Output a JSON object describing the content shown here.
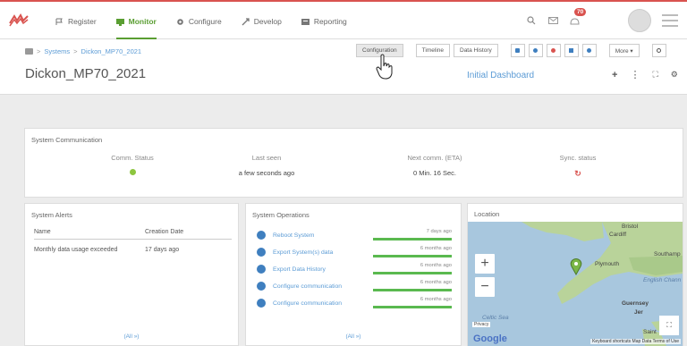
{
  "nav": {
    "items": [
      {
        "label": "Register",
        "icon": "flag-icon"
      },
      {
        "label": "Monitor",
        "icon": "monitor-icon",
        "active": true
      },
      {
        "label": "Configure",
        "icon": "gear-icon"
      },
      {
        "label": "Develop",
        "icon": "develop-icon"
      },
      {
        "label": "Reporting",
        "icon": "report-icon"
      }
    ],
    "notifications_count": "70"
  },
  "breadcrumb": {
    "root": "Systems",
    "current": "Dickon_MP70_2021"
  },
  "page_title": "Dickon_MP70_2021",
  "toolbar": {
    "configuration": "Configuration",
    "timeline": "Timeline",
    "data_history": "Data History",
    "more": "More ▾"
  },
  "dashboard_title": "Initial Dashboard",
  "communication": {
    "title": "System Communication",
    "comm_status_label": "Comm. Status",
    "last_seen_label": "Last seen",
    "last_seen_value": "a few seconds ago",
    "next_comm_label": "Next comm. (ETA)",
    "next_comm_value": "0 Min. 16 Sec.",
    "sync_label": "Sync. status"
  },
  "alerts": {
    "title": "System Alerts",
    "col_name": "Name",
    "col_date": "Creation Date",
    "rows": [
      {
        "name": "Monthly data usage exceeded",
        "date": "17 days ago"
      }
    ],
    "all_link": "(All »)"
  },
  "operations": {
    "title": "System Operations",
    "items": [
      {
        "label": "Reboot System",
        "time": "7 days ago"
      },
      {
        "label": "Export System(s) data",
        "time": "6 months ago"
      },
      {
        "label": "Export Data History",
        "time": "6 months ago"
      },
      {
        "label": "Configure communication",
        "time": "6 months ago"
      },
      {
        "label": "Configure communication",
        "time": "6 months ago"
      }
    ],
    "all_link": "(All »)"
  },
  "location": {
    "title": "Location",
    "labels": {
      "bristol": "Bristol",
      "cardiff": "Cardiff",
      "southampton": "Southamp",
      "plymouth": "Plymouth",
      "channel": "English Chann",
      "celtic": "Celtic Sea",
      "guernsey": "Guernsey",
      "jersey": "Jer",
      "saint": "Saint",
      "privacy": "Privacy"
    },
    "google": "Google",
    "footer": "Keyboard shortcuts   Map Data   Terms of Use"
  },
  "colors": {
    "accent_green": "#5a9e32",
    "link_blue": "#5b9bd5",
    "alert_red": "#d9534f"
  }
}
